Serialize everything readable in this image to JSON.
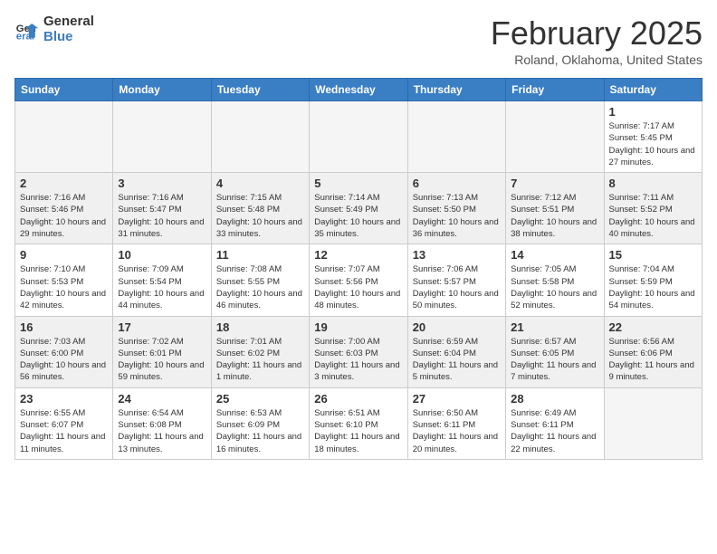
{
  "header": {
    "logo": {
      "general": "General",
      "blue": "Blue"
    },
    "title": "February 2025",
    "location": "Roland, Oklahoma, United States"
  },
  "calendar": {
    "days_of_week": [
      "Sunday",
      "Monday",
      "Tuesday",
      "Wednesday",
      "Thursday",
      "Friday",
      "Saturday"
    ],
    "weeks": [
      {
        "shaded": false,
        "days": [
          {
            "num": "",
            "info": ""
          },
          {
            "num": "",
            "info": ""
          },
          {
            "num": "",
            "info": ""
          },
          {
            "num": "",
            "info": ""
          },
          {
            "num": "",
            "info": ""
          },
          {
            "num": "",
            "info": ""
          },
          {
            "num": "1",
            "info": "Sunrise: 7:17 AM\nSunset: 5:45 PM\nDaylight: 10 hours and 27 minutes."
          }
        ]
      },
      {
        "shaded": true,
        "days": [
          {
            "num": "2",
            "info": "Sunrise: 7:16 AM\nSunset: 5:46 PM\nDaylight: 10 hours and 29 minutes."
          },
          {
            "num": "3",
            "info": "Sunrise: 7:16 AM\nSunset: 5:47 PM\nDaylight: 10 hours and 31 minutes."
          },
          {
            "num": "4",
            "info": "Sunrise: 7:15 AM\nSunset: 5:48 PM\nDaylight: 10 hours and 33 minutes."
          },
          {
            "num": "5",
            "info": "Sunrise: 7:14 AM\nSunset: 5:49 PM\nDaylight: 10 hours and 35 minutes."
          },
          {
            "num": "6",
            "info": "Sunrise: 7:13 AM\nSunset: 5:50 PM\nDaylight: 10 hours and 36 minutes."
          },
          {
            "num": "7",
            "info": "Sunrise: 7:12 AM\nSunset: 5:51 PM\nDaylight: 10 hours and 38 minutes."
          },
          {
            "num": "8",
            "info": "Sunrise: 7:11 AM\nSunset: 5:52 PM\nDaylight: 10 hours and 40 minutes."
          }
        ]
      },
      {
        "shaded": false,
        "days": [
          {
            "num": "9",
            "info": "Sunrise: 7:10 AM\nSunset: 5:53 PM\nDaylight: 10 hours and 42 minutes."
          },
          {
            "num": "10",
            "info": "Sunrise: 7:09 AM\nSunset: 5:54 PM\nDaylight: 10 hours and 44 minutes."
          },
          {
            "num": "11",
            "info": "Sunrise: 7:08 AM\nSunset: 5:55 PM\nDaylight: 10 hours and 46 minutes."
          },
          {
            "num": "12",
            "info": "Sunrise: 7:07 AM\nSunset: 5:56 PM\nDaylight: 10 hours and 48 minutes."
          },
          {
            "num": "13",
            "info": "Sunrise: 7:06 AM\nSunset: 5:57 PM\nDaylight: 10 hours and 50 minutes."
          },
          {
            "num": "14",
            "info": "Sunrise: 7:05 AM\nSunset: 5:58 PM\nDaylight: 10 hours and 52 minutes."
          },
          {
            "num": "15",
            "info": "Sunrise: 7:04 AM\nSunset: 5:59 PM\nDaylight: 10 hours and 54 minutes."
          }
        ]
      },
      {
        "shaded": true,
        "days": [
          {
            "num": "16",
            "info": "Sunrise: 7:03 AM\nSunset: 6:00 PM\nDaylight: 10 hours and 56 minutes."
          },
          {
            "num": "17",
            "info": "Sunrise: 7:02 AM\nSunset: 6:01 PM\nDaylight: 10 hours and 59 minutes."
          },
          {
            "num": "18",
            "info": "Sunrise: 7:01 AM\nSunset: 6:02 PM\nDaylight: 11 hours and 1 minute."
          },
          {
            "num": "19",
            "info": "Sunrise: 7:00 AM\nSunset: 6:03 PM\nDaylight: 11 hours and 3 minutes."
          },
          {
            "num": "20",
            "info": "Sunrise: 6:59 AM\nSunset: 6:04 PM\nDaylight: 11 hours and 5 minutes."
          },
          {
            "num": "21",
            "info": "Sunrise: 6:57 AM\nSunset: 6:05 PM\nDaylight: 11 hours and 7 minutes."
          },
          {
            "num": "22",
            "info": "Sunrise: 6:56 AM\nSunset: 6:06 PM\nDaylight: 11 hours and 9 minutes."
          }
        ]
      },
      {
        "shaded": false,
        "days": [
          {
            "num": "23",
            "info": "Sunrise: 6:55 AM\nSunset: 6:07 PM\nDaylight: 11 hours and 11 minutes."
          },
          {
            "num": "24",
            "info": "Sunrise: 6:54 AM\nSunset: 6:08 PM\nDaylight: 11 hours and 13 minutes."
          },
          {
            "num": "25",
            "info": "Sunrise: 6:53 AM\nSunset: 6:09 PM\nDaylight: 11 hours and 16 minutes."
          },
          {
            "num": "26",
            "info": "Sunrise: 6:51 AM\nSunset: 6:10 PM\nDaylight: 11 hours and 18 minutes."
          },
          {
            "num": "27",
            "info": "Sunrise: 6:50 AM\nSunset: 6:11 PM\nDaylight: 11 hours and 20 minutes."
          },
          {
            "num": "28",
            "info": "Sunrise: 6:49 AM\nSunset: 6:11 PM\nDaylight: 11 hours and 22 minutes."
          },
          {
            "num": "",
            "info": ""
          }
        ]
      }
    ]
  }
}
